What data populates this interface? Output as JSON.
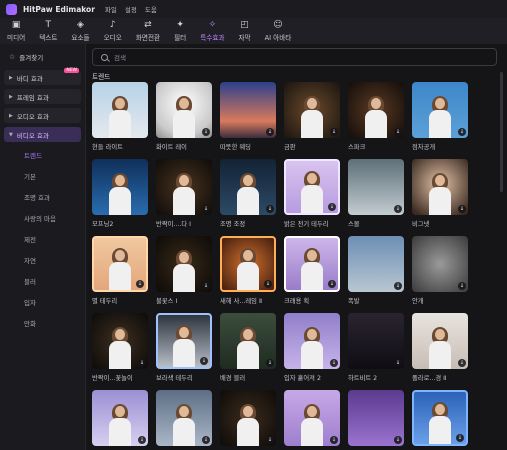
{
  "app": {
    "name": "HitPaw Edimakor",
    "menu": [
      "파일",
      "설정",
      "도움"
    ]
  },
  "toolbar": [
    {
      "icon": "media-icon",
      "glyph": "▣",
      "label": "미디어"
    },
    {
      "icon": "text-icon",
      "glyph": "T",
      "label": "텍스트"
    },
    {
      "icon": "elements-icon",
      "glyph": "◈",
      "label": "요소들"
    },
    {
      "icon": "audio-icon",
      "glyph": "♪",
      "label": "오디오"
    },
    {
      "icon": "transition-icon",
      "glyph": "⇄",
      "label": "화면전환"
    },
    {
      "icon": "filter-icon",
      "glyph": "✦",
      "label": "필터"
    },
    {
      "icon": "effects-icon",
      "glyph": "✧",
      "label": "특수효과",
      "active": true
    },
    {
      "icon": "caption-icon",
      "glyph": "◰",
      "label": "자막"
    },
    {
      "icon": "ai-avatar-icon",
      "glyph": "☺",
      "label": "AI 아바타"
    }
  ],
  "sidebar": {
    "favorites": "즐겨찾기",
    "categories": [
      {
        "label": "바디 효과",
        "badge": "NEW"
      },
      {
        "label": "프레임 효과"
      },
      {
        "label": "오디오 효과"
      },
      {
        "label": "비디오 효과",
        "open": true
      }
    ],
    "sub_items": [
      "트렌드",
      "기본",
      "조명 효과",
      "사랑의 마음",
      "제전",
      "자연",
      "블러",
      "입자",
      "만화"
    ],
    "active_sub": "트렌드"
  },
  "search": {
    "placeholder": "검색"
  },
  "section_title": "트렌드",
  "effects": [
    {
      "label": "현들 라이트"
    },
    {
      "label": "화이트 레이"
    },
    {
      "label": "따뜻한 웨딩"
    },
    {
      "label": "금판"
    },
    {
      "label": "스파크"
    },
    {
      "label": "점차공개"
    },
    {
      "label": "모프닝2"
    },
    {
      "label": "반짝이....다 Ⅰ"
    },
    {
      "label": "조명 조정"
    },
    {
      "label": "밝은 전기 테두리"
    },
    {
      "label": "스몰"
    },
    {
      "label": "비그넷"
    },
    {
      "label": "별 테두리"
    },
    {
      "label": "불꽃스 Ⅰ"
    },
    {
      "label": "새해 사...레임 Ⅱ"
    },
    {
      "label": "크래용 획"
    },
    {
      "label": "폭발"
    },
    {
      "label": "안개"
    },
    {
      "label": "반짝이...꽃놀이"
    },
    {
      "label": "보라색 테두리"
    },
    {
      "label": "배경 블러"
    },
    {
      "label": "입자 흩어져 2"
    },
    {
      "label": "하트비트 2"
    },
    {
      "label": "폴라로...경 Ⅱ"
    },
    {
      "label": ""
    },
    {
      "label": ""
    },
    {
      "label": ""
    },
    {
      "label": ""
    },
    {
      "label": ""
    },
    {
      "label": ""
    }
  ]
}
